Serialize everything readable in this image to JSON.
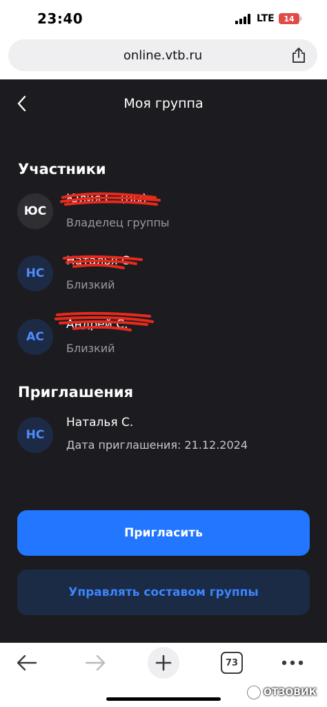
{
  "status_bar": {
    "time": "23:40",
    "network": "LTE",
    "battery": "14",
    "battery_color": "#e04a47"
  },
  "browser": {
    "url": "online.vtb.ru",
    "share_icon": "share-icon",
    "tab_count": "73"
  },
  "header": {
    "back_icon": "chevron-left-icon",
    "title": "Моя группа"
  },
  "members_section": {
    "title": "Участники",
    "members": [
      {
        "initials": "ЮС",
        "name": "Юлия С. (Вы)",
        "role": "Владелец группы",
        "avatar_style": "grey",
        "name_redacted": true
      },
      {
        "initials": "НС",
        "name": "Наталья С.",
        "role": "Близкий",
        "avatar_style": "blue",
        "name_redacted": true
      },
      {
        "initials": "АС",
        "name": "Андрей С.",
        "role": "Близкий",
        "avatar_style": "blue",
        "name_redacted": true
      }
    ]
  },
  "invitations_section": {
    "title": "Приглашения",
    "invitations": [
      {
        "initials": "НС",
        "name": "Наталья С.",
        "date_label": "Дата приглашения: 21.12.2024",
        "avatar_style": "blue"
      }
    ]
  },
  "actions": {
    "invite_label": "Пригласить",
    "manage_label": "Управлять составом группы"
  },
  "colors": {
    "background": "#1c1c20",
    "primary": "#2276ff",
    "secondary_bg": "#1b2a45",
    "secondary_text": "#3d84ff",
    "redaction": "#e8291c"
  },
  "watermark": {
    "text": "ОТЗОВИК"
  }
}
